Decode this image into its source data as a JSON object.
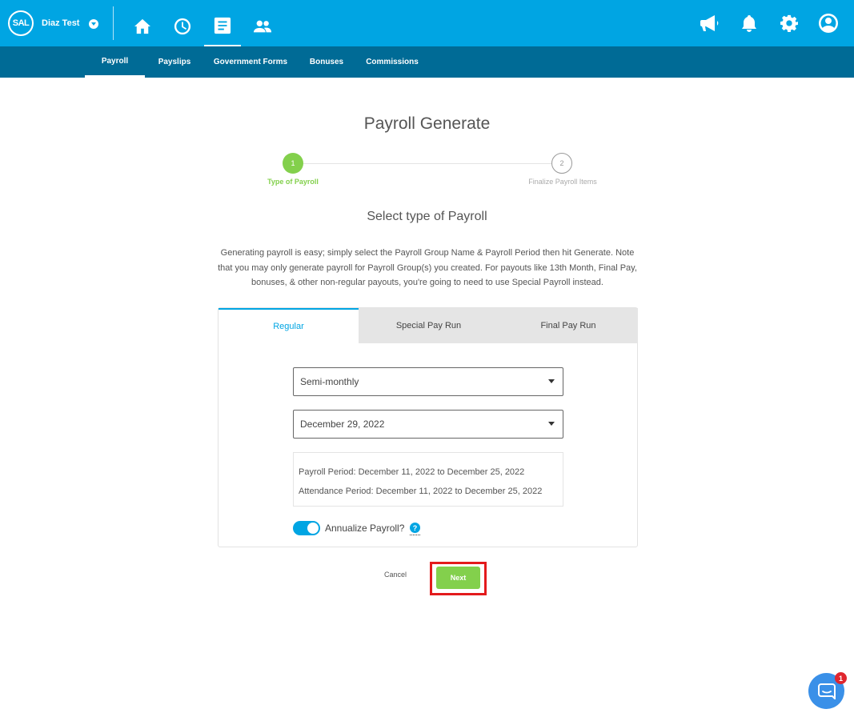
{
  "header": {
    "logo_text": "SAL",
    "company_name": "Diaz Test",
    "nav_icons": [
      "home-icon",
      "clock-icon",
      "document-icon",
      "people-icon"
    ],
    "right_icons": [
      "megaphone-icon",
      "bell-icon",
      "gear-icon",
      "user-icon"
    ],
    "colors": {
      "primary": "#00a5e3",
      "secondary": "#006b96",
      "accent": "#83d04c"
    }
  },
  "subnav": {
    "tabs": [
      {
        "label": "Payroll"
      },
      {
        "label": "Payslips"
      },
      {
        "label": "Government Forms"
      },
      {
        "label": "Bonuses"
      },
      {
        "label": "Commissions"
      }
    ]
  },
  "page": {
    "title": "Payroll Generate",
    "steps": [
      {
        "number": "1",
        "label": "Type of Payroll"
      },
      {
        "number": "2",
        "label": "Finalize Payroll Items"
      }
    ],
    "section_title": "Select type of Payroll",
    "intro": "Generating payroll is easy; simply select the Payroll Group Name & Payroll Period then hit Generate. Note that you may only generate payroll for Payroll Group(s) you created. For payouts like 13th Month, Final Pay, bonuses, & other non-regular payouts, you're going to need to use Special Payroll instead."
  },
  "card": {
    "tabs": [
      {
        "label": "Regular"
      },
      {
        "label": "Special Pay Run"
      },
      {
        "label": "Final Pay Run"
      }
    ],
    "payroll_group": "Semi-monthly",
    "payroll_date": "December 29, 2022",
    "payroll_period": "Payroll Period: December 11, 2022 to December 25, 2022",
    "attendance_period": "Attendance Period: December 11, 2022 to December 25, 2022",
    "annualize_label": "Annualize Payroll?",
    "help_mark": "?"
  },
  "actions": {
    "cancel_label": "Cancel",
    "next_label": "Next"
  },
  "chat": {
    "badge_count": "1"
  }
}
